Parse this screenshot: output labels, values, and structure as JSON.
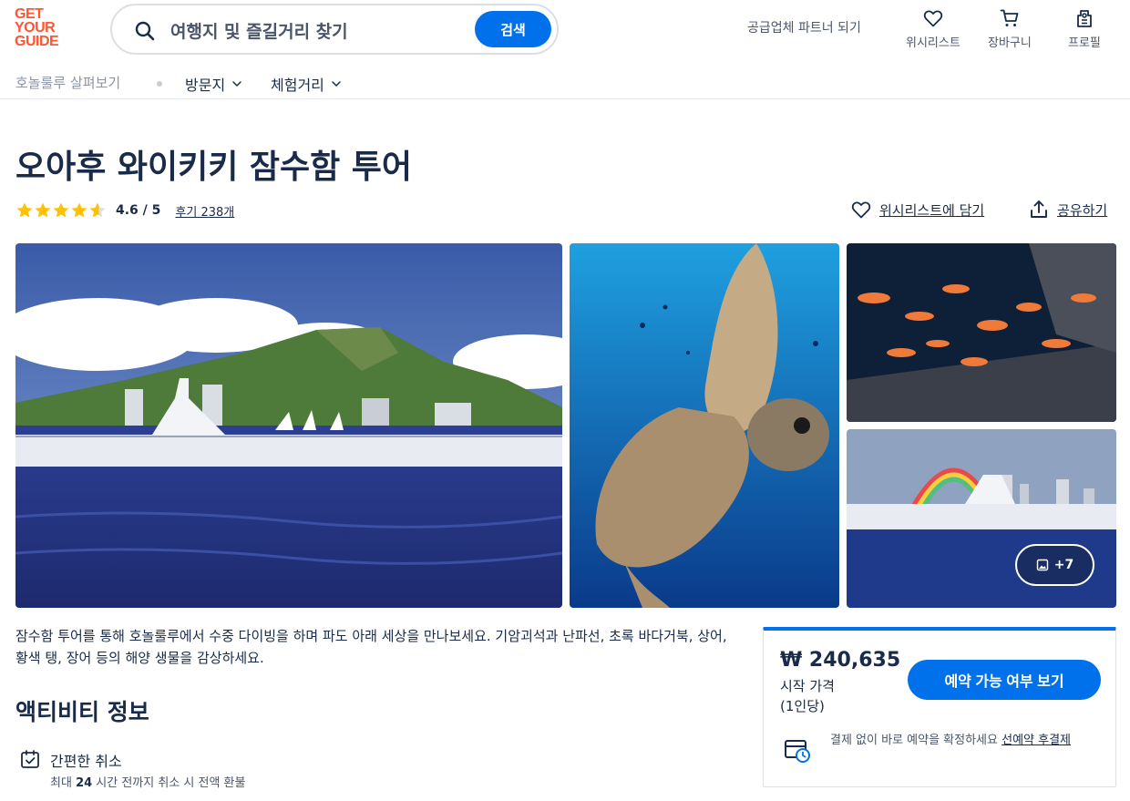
{
  "colors": {
    "brand": "#ff5533",
    "accent": "#0071eb",
    "text": "#1a2b49",
    "star": "#ffc107"
  },
  "header": {
    "logo_lines": [
      "GET",
      "YOUR",
      "GUIDE"
    ],
    "search_placeholder": "여행지 및 즐길거리 찾기",
    "search_button": "검색",
    "partner_link": "공급업체 파트너 되기",
    "wishlist": "위시리스트",
    "cart": "장바구니",
    "profile": "프로필"
  },
  "subnav": {
    "breadcrumb": "호놀룰루 살펴보기",
    "items": [
      {
        "label": "방문지"
      },
      {
        "label": "체험거리"
      }
    ]
  },
  "activity": {
    "title": "오아후 와이키키 잠수함 투어",
    "rating": 4.6,
    "rating_text": "4.6 / 5",
    "reviews_text": "후기 238개",
    "wishlist_action": "위시리스트에 담기",
    "share_action": "공유하기"
  },
  "gallery": {
    "more_label": "+7",
    "images": [
      {
        "name": "submarine-diamond-head-photo",
        "icon": "photo"
      },
      {
        "name": "sea-turtle-photo",
        "icon": "photo"
      },
      {
        "name": "fish-shipwreck-photo",
        "icon": "photo"
      },
      {
        "name": "submarine-rainbow-photo",
        "icon": "photo"
      }
    ]
  },
  "description": "잠수함 투어를 통해 호놀룰루에서 수중 다이빙을 하며 파도 아래 세상을 만나보세요. 기암괴석과 난파선, 초록 바다거북, 상어, 황색 탱, 장어 등의 해양 생물을 감상하세요.",
  "info": {
    "title": "액티비티 정보",
    "features": [
      {
        "icon": "calendar-check-icon",
        "title": "간편한 취소",
        "subtitle_pre": "최대 ",
        "subtitle_bold": "24",
        "subtitle_post": " 시간 전까지 취소 시 전액 환불"
      }
    ]
  },
  "booking": {
    "price": "₩ 240,635",
    "from_label": "시작 가격",
    "per_person": "(1인당)",
    "button": "예약 가능 여부 보기",
    "note": "결제 없이 바로 예약을 확정하세요 ",
    "note_link": "선예약 후결제"
  }
}
